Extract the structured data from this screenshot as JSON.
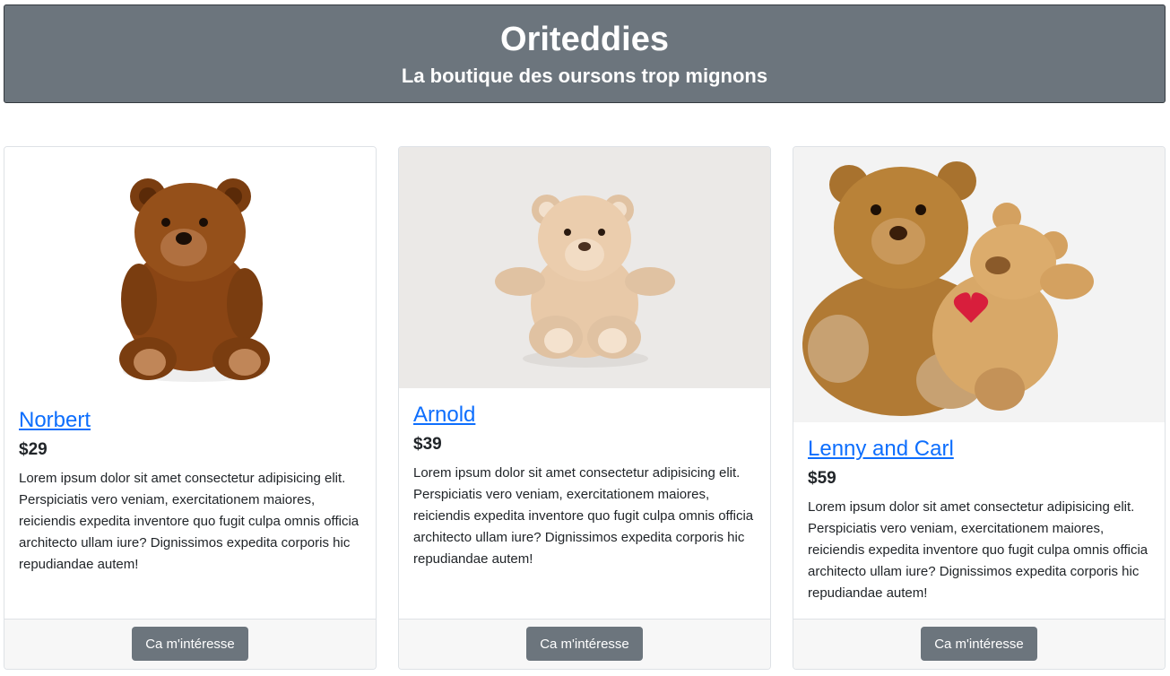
{
  "header": {
    "title": "Oriteddies",
    "subtitle": "La boutique des oursons trop mignons"
  },
  "products": [
    {
      "name": "Norbert",
      "price": "$29",
      "description": "Lorem ipsum dolor sit amet consectetur adipisicing elit. Perspiciatis vero veniam, exercitationem maiores, reiciendis expedita inventore quo fugit culpa omnis officia architecto ullam iure? Dignissimos expedita corporis hic repudiandae autem!",
      "button_label": "Ca m'intéresse",
      "image_icon": "brown-teddy-bear"
    },
    {
      "name": "Arnold",
      "price": "$39",
      "description": "Lorem ipsum dolor sit amet consectetur adipisicing elit. Perspiciatis vero veniam, exercitationem maiores, reiciendis expedita inventore quo fugit culpa omnis officia architecto ullam iure? Dignissimos expedita corporis hic repudiandae autem!",
      "button_label": "Ca m'intéresse",
      "image_icon": "beige-teddy-bear"
    },
    {
      "name": "Lenny and Carl",
      "price": "$59",
      "description": "Lorem ipsum dolor sit amet consectetur adipisicing elit. Perspiciatis vero veniam, exercitationem maiores, reiciendis expedita inventore quo fugit culpa omnis officia architecto ullam iure? Dignissimos expedita corporis hic repudiandae autem!",
      "button_label": "Ca m'intéresse",
      "image_icon": "two-teddy-bears"
    }
  ],
  "colors": {
    "header_bg": "#6c757d",
    "link": "#0d6efd",
    "button_bg": "#6c757d",
    "footer_bg": "#f7f7f7"
  }
}
